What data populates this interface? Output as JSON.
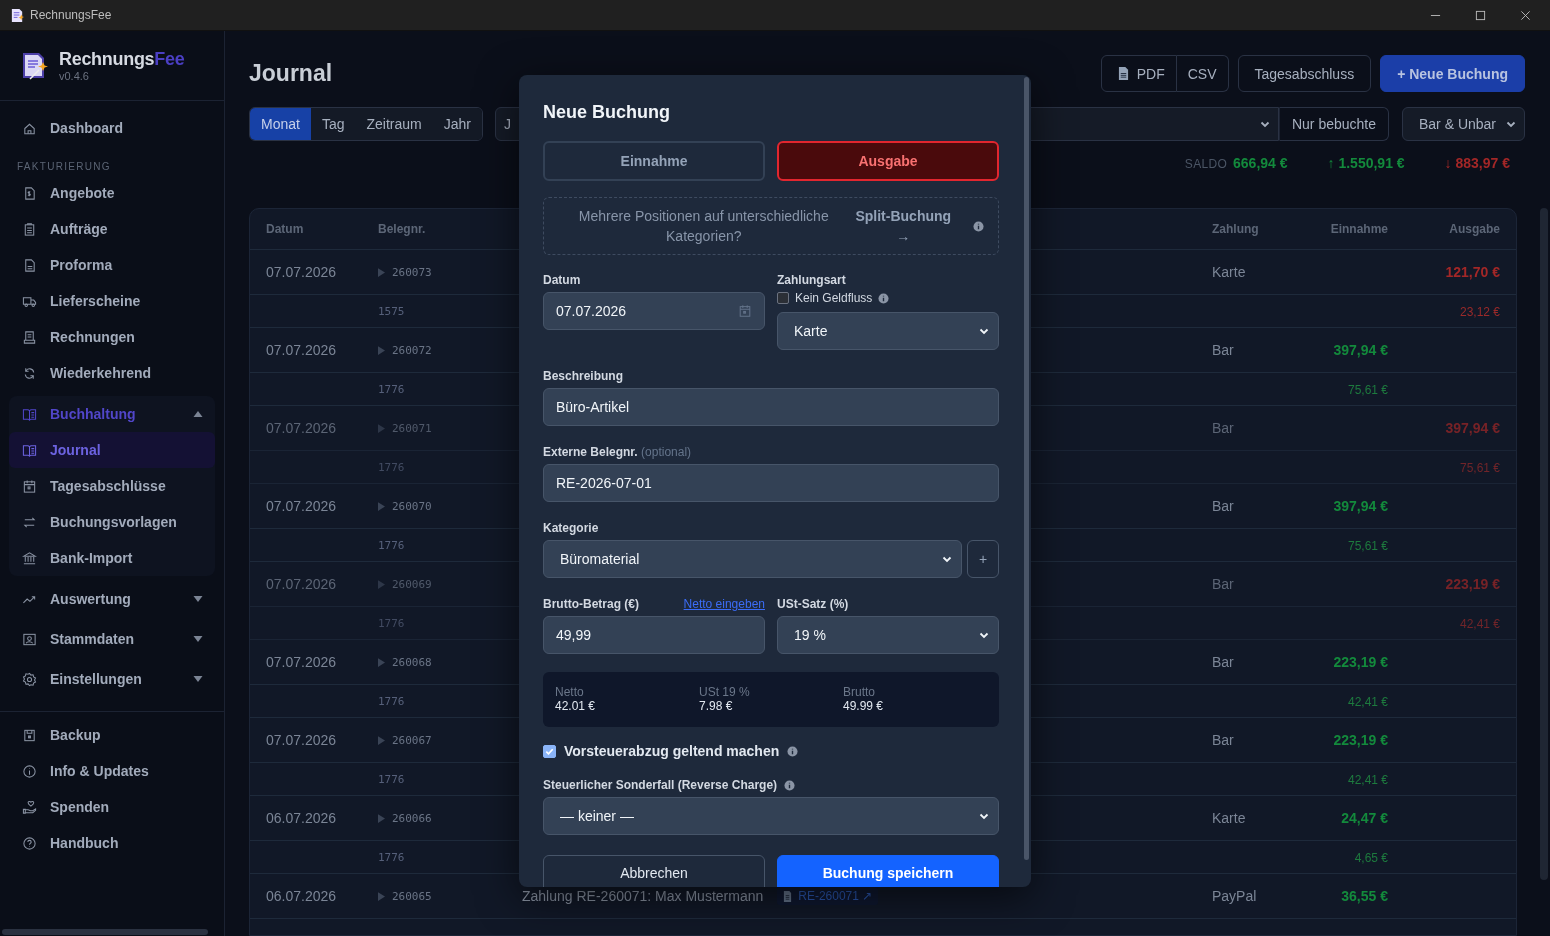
{
  "window": {
    "title": "RechnungsFee"
  },
  "sidebar": {
    "brand": {
      "name": "Rechnungs",
      "accent": "Fee",
      "version": "v0.4.6"
    },
    "sections": [
      {
        "items": [
          {
            "label": "Dashboard",
            "selected": false
          }
        ]
      },
      {
        "heading": "FAKTURIERUNG",
        "items": [
          {
            "label": "Angebote",
            "selected": false
          },
          {
            "label": "Aufträge",
            "selected": false
          },
          {
            "label": "Proforma",
            "selected": false
          },
          {
            "label": "Lieferscheine",
            "selected": false
          },
          {
            "label": "Rechnungen",
            "selected": false
          },
          {
            "label": "Wiederkehrend",
            "selected": false
          }
        ]
      },
      {
        "items": [
          {
            "label": "Buchhaltung",
            "selected": false,
            "expanded": true,
            "children": [
              {
                "label": "Journal",
                "selected": true
              },
              {
                "label": "Tagesabschlüsse",
                "selected": false
              },
              {
                "label": "Buchungsvorlagen",
                "selected": false
              },
              {
                "label": "Bank-Import",
                "selected": false
              }
            ]
          },
          {
            "label": "Auswertung",
            "selected": false,
            "expanded": false
          },
          {
            "label": "Stammdaten",
            "selected": false,
            "expanded": false
          },
          {
            "label": "Einstellungen",
            "selected": false,
            "expanded": false
          }
        ]
      },
      {
        "items": [
          {
            "label": "Backup",
            "selected": false
          },
          {
            "label": "Info & Updates",
            "selected": false
          },
          {
            "label": "Spenden",
            "selected": false
          },
          {
            "label": "Handbuch",
            "selected": false
          }
        ]
      }
    ]
  },
  "page": {
    "title": "Journal",
    "actions": [
      {
        "label": "PDF",
        "kind": "pdf"
      },
      {
        "label": "CSV",
        "kind": "csv"
      },
      {
        "label": "Tagesabschluss",
        "kind": "plain"
      },
      {
        "label": "+ Neue Buchung",
        "kind": "primary"
      }
    ],
    "period_tabs": [
      {
        "label": "Monat",
        "selected": true
      },
      {
        "label": "Tag",
        "selected": false
      },
      {
        "label": "Zeitraum",
        "selected": false
      },
      {
        "label": "Jahr",
        "selected": false
      }
    ],
    "account_select": {
      "value": "J"
    },
    "booked_only": {
      "label": "Nur bebuchte"
    },
    "cash_filter": {
      "value": "Bar & Unbar"
    },
    "totals": {
      "label": "SALDO",
      "saldo": "666,94 €",
      "income": "↑ 1.550,91 €",
      "expense": "↓ 883,97 €"
    }
  },
  "table": {
    "columns": [
      "Datum",
      "Belegnr.",
      "Zahlung",
      "Einnahme",
      "Ausgabe"
    ],
    "rows": [
      {
        "date": "07.07.2026",
        "receipt": "260073",
        "payment": "Karte",
        "expense": "121,70 €",
        "dimmed": false,
        "sub": {
          "receipt": "1575",
          "expense": "23,12 €"
        }
      },
      {
        "date": "07.07.2026",
        "receipt": "260072",
        "payment": "Bar",
        "income": "397,94 €",
        "dimmed": false,
        "sub": {
          "receipt": "1776",
          "income": "75,61 €"
        }
      },
      {
        "date": "07.07.2026",
        "receipt": "260071",
        "payment": "Bar",
        "expense": "397,94 €",
        "dimmed": true,
        "sub": {
          "receipt": "1776",
          "expense": "75,61 €"
        }
      },
      {
        "date": "07.07.2026",
        "receipt": "260070",
        "payment": "Bar",
        "income": "397,94 €",
        "dimmed": false,
        "sub": {
          "receipt": "1776",
          "income": "75,61 €"
        }
      },
      {
        "date": "07.07.2026",
        "receipt": "260069",
        "payment": "Bar",
        "expense": "223,19 €",
        "dimmed": true,
        "sub": {
          "receipt": "1776",
          "expense": "42,41 €"
        }
      },
      {
        "date": "07.07.2026",
        "receipt": "260068",
        "payment": "Bar",
        "income": "223,19 €",
        "dimmed": false,
        "sub": {
          "receipt": "1776",
          "income": "42,41 €"
        }
      },
      {
        "date": "07.07.2026",
        "receipt": "260067",
        "payment": "Bar",
        "income": "223,19 €",
        "dimmed": false,
        "sub": {
          "receipt": "1776",
          "income": "42,41 €"
        }
      },
      {
        "date": "06.07.2026",
        "receipt": "260066",
        "payment": "Karte",
        "income": "24,47 €",
        "dimmed": false,
        "sub": {
          "receipt": "1776",
          "income": "4,65 €"
        }
      },
      {
        "date": "06.07.2026",
        "receipt": "260065",
        "payment": "PayPal",
        "income": "36,55 €",
        "dimmed": false,
        "description": "Zahlung RE-260071: Max Mustermann",
        "link": "RE-260071 ↗"
      }
    ]
  },
  "dialog": {
    "title": "Neue Buchung",
    "types": [
      {
        "label": "Einnahme",
        "selected": false
      },
      {
        "label": "Ausgabe",
        "selected": true
      }
    ],
    "split_hint": {
      "text": "Mehrere Positionen auf unterschiedliche Kategorien?",
      "link": "Split-Buchung →"
    },
    "date": {
      "label": "Datum",
      "value": "07.07.2026"
    },
    "payment": {
      "label": "Zahlungsart",
      "no_cashflow": {
        "label": "Kein Geldfluss",
        "checked": false
      },
      "value": "Karte"
    },
    "description": {
      "label": "Beschreibung",
      "value": "Büro-Artikel"
    },
    "external_receipt": {
      "label": "Externe Belegnr.",
      "hint": "(optional)",
      "value": "RE-2026-07-01"
    },
    "category": {
      "label": "Kategorie",
      "value": "Büromaterial",
      "add": "+"
    },
    "gross": {
      "label": "Brutto-Betrag (€)",
      "link": "Netto eingeben",
      "value": "49,99"
    },
    "vat_rate": {
      "label": "USt-Satz (%)",
      "value": "19 %"
    },
    "summary": [
      {
        "label": "Netto",
        "value": "42.01 €"
      },
      {
        "label": "USt 19 %",
        "value": "7.98 €"
      },
      {
        "label": "Brutto",
        "value": "49.99 €"
      }
    ],
    "input_tax": {
      "label": "Vorsteuerabzug geltend machen",
      "checked": true
    },
    "special_case": {
      "label": "Steuerlicher Sonderfall (Reverse Charge)",
      "value": "— keiner —"
    },
    "buttons": [
      {
        "label": "Abbrechen",
        "kind": "secondary"
      },
      {
        "label": "Buchung speichern",
        "kind": "primary"
      }
    ]
  }
}
